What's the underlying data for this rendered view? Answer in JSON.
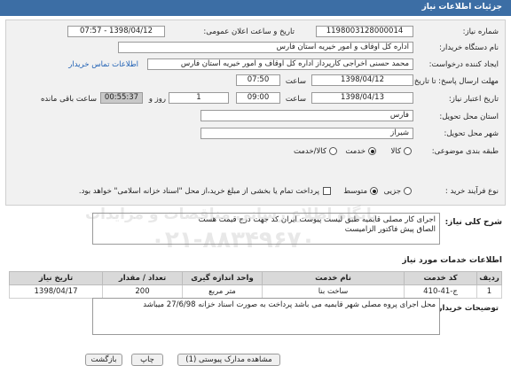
{
  "header": {
    "title": "جزئیات اطلاعات نیاز"
  },
  "form": {
    "need_number_label": "شماره نیاز:",
    "need_number": "1198003128000014",
    "announce_label": "تاریخ و ساعت اعلان عمومی:",
    "announce_value": "1398/04/12 - 07:57",
    "buyer_label": "نام دستگاه خریدار:",
    "buyer_value": "اداره کل اوقاف و امور خیریه استان فارس",
    "creator_label": "ایجاد کننده درخواست:",
    "creator_value": "محمد حسنی اخراجی کارپرداز اداره کل اوقاف و امور خیریه استان فارس",
    "contact_link": "اطلاعات تماس خریدار",
    "reply_deadline_label": "مهلت ارسال پاسخ: تا تاریخ:",
    "reply_date": "1398/04/12",
    "time_label": "ساعت",
    "reply_time": "07:50",
    "validity_label": "تاریخ اعتبار نیاز:",
    "validity_date": "1398/04/13",
    "validity_time_label": "ساعت",
    "validity_time": "09:00",
    "days_value": "1",
    "days_label": "روز و",
    "remaining_time": "00:55:37",
    "remaining_label": "ساعت باقی مانده",
    "province_label": "استان محل تحویل:",
    "province_value": "فارس",
    "city_label": "شهر محل تحویل:",
    "city_value": "شیراز",
    "category_label": "طبقه بندی موضوعی:",
    "category_options": [
      "کالا",
      "خدمت",
      "کالا/خدمت"
    ],
    "category_selected": "خدمت",
    "process_label": "نوع فرآیند خرید :",
    "process_options": [
      "جزیی",
      "متوسط"
    ],
    "process_selected": "متوسط",
    "payment_note": "پرداخت تمام یا بخشی از مبلغ خرید،از محل \"اسناد خزانه اسلامی\" خواهد بود."
  },
  "description": {
    "label": "شرح کلی نیاز:",
    "line1": "اجرای کار مصلی قابمیه طبق لیست پیوست ایران کد جهت درج قیمت هست",
    "line2": "الصاق پیش فاکتور الزامیست"
  },
  "services": {
    "title": "اطلاعات خدمات مورد نیاز",
    "headers": [
      "ردیف",
      "کد خدمت",
      "نام خدمت",
      "واحد اندازه گیری",
      "تعداد / مقدار",
      "تاریخ نیاز"
    ],
    "rows": [
      [
        "1",
        "ج-41-410",
        "ساخت بنا",
        "متر مربع",
        "200",
        "1398/04/17"
      ]
    ]
  },
  "buyer_notes": {
    "label": "توضیحات خریدار:",
    "text": "محل اجرای پروه مصلی شهر قابمیه می باشد پرداخت به صورت اسناد خزانه 27/6/98 میباشد"
  },
  "footer": {
    "btn_back": "بازگشت",
    "btn_print": "چاپ",
    "btn_view": "مشاهده مدارک پیوستی (1)"
  },
  "watermark": {
    "line1": "پایگاه اطلاع رسانی مناقصات و مزایدات",
    "line2": "۰۲۱-۸۸۳۴۹۶۷۰"
  }
}
